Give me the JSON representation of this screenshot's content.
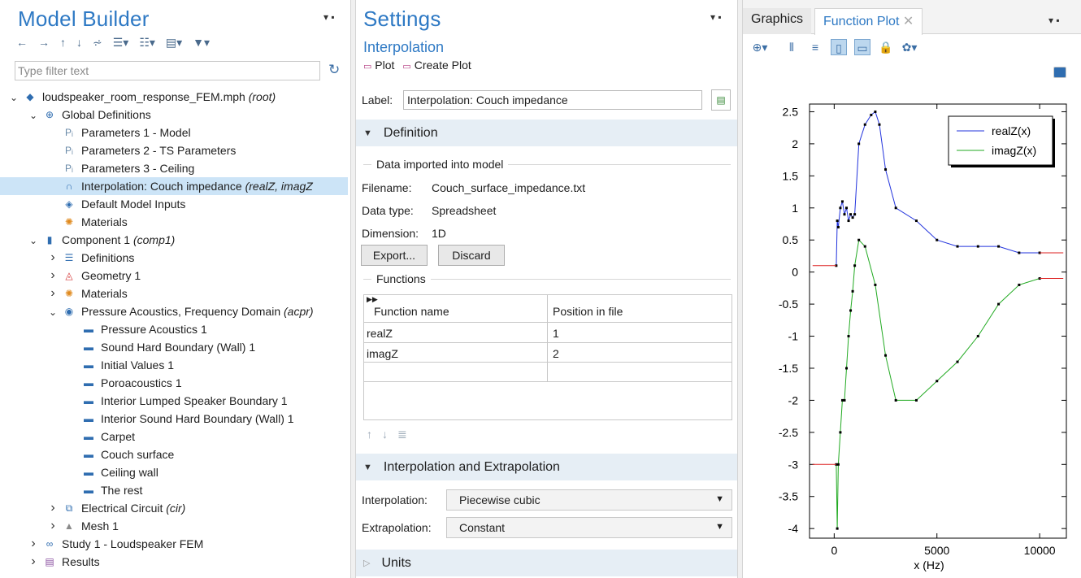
{
  "model_builder": {
    "title": "Model Builder",
    "filter_placeholder": "Type filter text",
    "toolbar_icons": [
      "arrow-left-icon",
      "arrow-right-icon",
      "arrow-up-icon",
      "arrow-down-icon",
      "show-icon",
      "expand-icon",
      "collapse-icon",
      "list-icon",
      "filter-icon"
    ],
    "tree": [
      {
        "indent": 0,
        "twisty": "open",
        "icon": "mph-file-icon",
        "label": "loudspeaker_room_response_FEM.mph",
        "tag": "(root)"
      },
      {
        "indent": 1,
        "twisty": "open",
        "icon": "globe-icon",
        "label": "Global Definitions",
        "tag": ""
      },
      {
        "indent": 2,
        "twisty": "none",
        "icon": "parameters-icon",
        "label": "Parameters 1 - Model",
        "tag": ""
      },
      {
        "indent": 2,
        "twisty": "none",
        "icon": "parameters-icon",
        "label": "Parameters 2 - TS Parameters",
        "tag": ""
      },
      {
        "indent": 2,
        "twisty": "none",
        "icon": "parameters-icon",
        "label": "Parameters 3 - Ceiling",
        "tag": ""
      },
      {
        "indent": 2,
        "twisty": "none",
        "icon": "interpolation-icon",
        "label": "Interpolation: Couch impedance",
        "tag": "(realZ, imagZ",
        "selected": true
      },
      {
        "indent": 2,
        "twisty": "none",
        "icon": "model-inputs-icon",
        "label": "Default Model Inputs",
        "tag": ""
      },
      {
        "indent": 2,
        "twisty": "none",
        "icon": "materials-icon",
        "label": "Materials",
        "tag": ""
      },
      {
        "indent": 1,
        "twisty": "open",
        "icon": "component-icon",
        "label": "Component 1",
        "tag": "(comp1)"
      },
      {
        "indent": 2,
        "twisty": "closed",
        "icon": "definitions-icon",
        "label": "Definitions",
        "tag": ""
      },
      {
        "indent": 2,
        "twisty": "closed",
        "icon": "geometry-icon",
        "label": "Geometry 1",
        "tag": ""
      },
      {
        "indent": 2,
        "twisty": "closed",
        "icon": "materials-small-icon",
        "label": "Materials",
        "tag": ""
      },
      {
        "indent": 2,
        "twisty": "open",
        "icon": "acoustics-icon",
        "label": "Pressure Acoustics, Frequency Domain",
        "tag": "(acpr)"
      },
      {
        "indent": 3,
        "twisty": "none",
        "icon": "domain-feature-icon",
        "label": "Pressure Acoustics 1",
        "tag": ""
      },
      {
        "indent": 3,
        "twisty": "none",
        "icon": "domain-feature-icon",
        "label": "Sound Hard Boundary (Wall) 1",
        "tag": ""
      },
      {
        "indent": 3,
        "twisty": "none",
        "icon": "domain-feature-icon",
        "label": "Initial Values 1",
        "tag": ""
      },
      {
        "indent": 3,
        "twisty": "none",
        "icon": "volume-feature-icon",
        "label": "Poroacoustics 1",
        "tag": ""
      },
      {
        "indent": 3,
        "twisty": "none",
        "icon": "boundary-feature-icon",
        "label": "Interior Lumped Speaker Boundary 1",
        "tag": ""
      },
      {
        "indent": 3,
        "twisty": "none",
        "icon": "boundary-feature-icon",
        "label": "Interior Sound Hard Boundary (Wall) 1",
        "tag": ""
      },
      {
        "indent": 3,
        "twisty": "none",
        "icon": "boundary-feature-icon",
        "label": "Carpet",
        "tag": ""
      },
      {
        "indent": 3,
        "twisty": "none",
        "icon": "boundary-feature-icon",
        "label": "Couch surface",
        "tag": ""
      },
      {
        "indent": 3,
        "twisty": "none",
        "icon": "boundary-feature-icon",
        "label": "Ceiling wall",
        "tag": ""
      },
      {
        "indent": 3,
        "twisty": "none",
        "icon": "boundary-feature-icon",
        "label": "The rest",
        "tag": ""
      },
      {
        "indent": 2,
        "twisty": "closed",
        "icon": "circuit-icon",
        "label": "Electrical Circuit",
        "tag": "(cir)"
      },
      {
        "indent": 2,
        "twisty": "closed",
        "icon": "mesh-icon",
        "label": "Mesh 1",
        "tag": ""
      },
      {
        "indent": 1,
        "twisty": "closed",
        "icon": "study-icon",
        "label": "Study 1 - Loudspeaker FEM",
        "tag": ""
      },
      {
        "indent": 1,
        "twisty": "closed",
        "icon": "results-icon",
        "label": "Results",
        "tag": ""
      }
    ]
  },
  "settings": {
    "title": "Settings",
    "subtitle": "Interpolation",
    "plot_label": "Plot",
    "create_plot_label": "Create Plot",
    "label_caption": "Label:",
    "label_value": "Interpolation: Couch impedance",
    "definition_section": "Definition",
    "data_group": "Data imported into model",
    "filename_caption": "Filename:",
    "filename_value": "Couch_surface_impedance.txt",
    "datatype_caption": "Data type:",
    "datatype_value": "Spreadsheet",
    "dimension_caption": "Dimension:",
    "dimension_value": "1D",
    "export_label": "Export...",
    "discard_label": "Discard",
    "functions_group": "Functions",
    "table_headers": [
      "Function name",
      "Position in file"
    ],
    "table_rows": [
      [
        "realZ",
        "1"
      ],
      [
        "imagZ",
        "2"
      ]
    ],
    "interp_section": "Interpolation and Extrapolation",
    "interpolation_caption": "Interpolation:",
    "interpolation_value": "Piecewise cubic",
    "extrapolation_caption": "Extrapolation:",
    "extrapolation_value": "Constant",
    "units_section": "Units"
  },
  "graphics": {
    "tabs": [
      {
        "label": "Graphics",
        "active": false
      },
      {
        "label": "Function Plot",
        "active": true
      }
    ]
  },
  "chart_data": {
    "type": "line",
    "xlabel": "x (Hz)",
    "ylabel": "",
    "xlim": [
      -1200,
      11300
    ],
    "ylim": [
      -4.15,
      2.62
    ],
    "xticks": [
      0,
      5000,
      10000
    ],
    "yticks": [
      2.5,
      2,
      1.5,
      1,
      0.5,
      0,
      -0.5,
      -1,
      -1.5,
      -2,
      -2.5,
      -3,
      -3.5,
      -4
    ],
    "grid": false,
    "legend_position": "top-right",
    "series": [
      {
        "name": "realZ(x)",
        "color": "#2233dd",
        "x": [
          100,
          150,
          200,
          300,
          400,
          500,
          600,
          700,
          800,
          900,
          1000,
          1200,
          1500,
          1800,
          2000,
          2200,
          2500,
          3000,
          4000,
          5000,
          6000,
          7000,
          8000,
          9000,
          10000
        ],
        "y": [
          0.1,
          0.8,
          0.7,
          1.0,
          1.1,
          0.9,
          1.0,
          0.8,
          0.9,
          0.85,
          0.9,
          2.0,
          2.3,
          2.45,
          2.5,
          2.3,
          1.6,
          1.0,
          0.8,
          0.5,
          0.4,
          0.4,
          0.4,
          0.3,
          0.3
        ],
        "extrap_left": 0.1,
        "extrap_right": 0.3
      },
      {
        "name": "imagZ(x)",
        "color": "#22aa22",
        "x": [
          100,
          150,
          200,
          300,
          400,
          500,
          600,
          700,
          800,
          900,
          1000,
          1200,
          1500,
          2000,
          2500,
          3000,
          4000,
          5000,
          6000,
          7000,
          8000,
          9000,
          10000
        ],
        "y": [
          -3.0,
          -4.0,
          -3.0,
          -2.5,
          -2.0,
          -2.0,
          -1.5,
          -1.0,
          -0.6,
          -0.3,
          0.1,
          0.5,
          0.4,
          -0.2,
          -1.3,
          -2.0,
          -2.0,
          -1.7,
          -1.4,
          -1.0,
          -0.5,
          -0.2,
          -0.1
        ],
        "extrap_left": -3.0,
        "extrap_right": -0.1
      }
    ],
    "extrap_color": "#dd2222"
  }
}
